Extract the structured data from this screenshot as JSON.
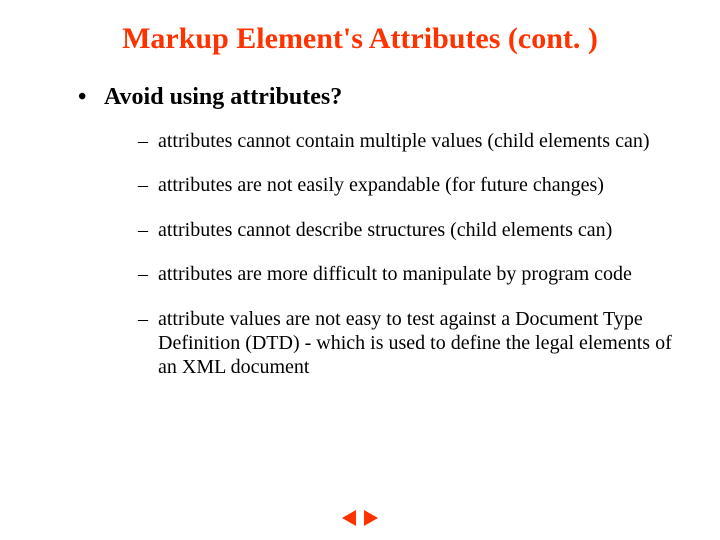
{
  "title": {
    "main": "Markup Element's Attributes",
    "cont": "(cont. )"
  },
  "heading": "Avoid using attributes?",
  "points": [
    "attributes cannot contain multiple values (child elements can)",
    "attributes are not easily expandable (for future changes)",
    "attributes cannot describe structures (child elements can)",
    "attributes are more difficult to manipulate by program code",
    "attribute values are not easy to test against a Document Type Definition (DTD) - which is used to define the legal elements of an XML document"
  ],
  "colors": {
    "accent": "#ff3300"
  }
}
